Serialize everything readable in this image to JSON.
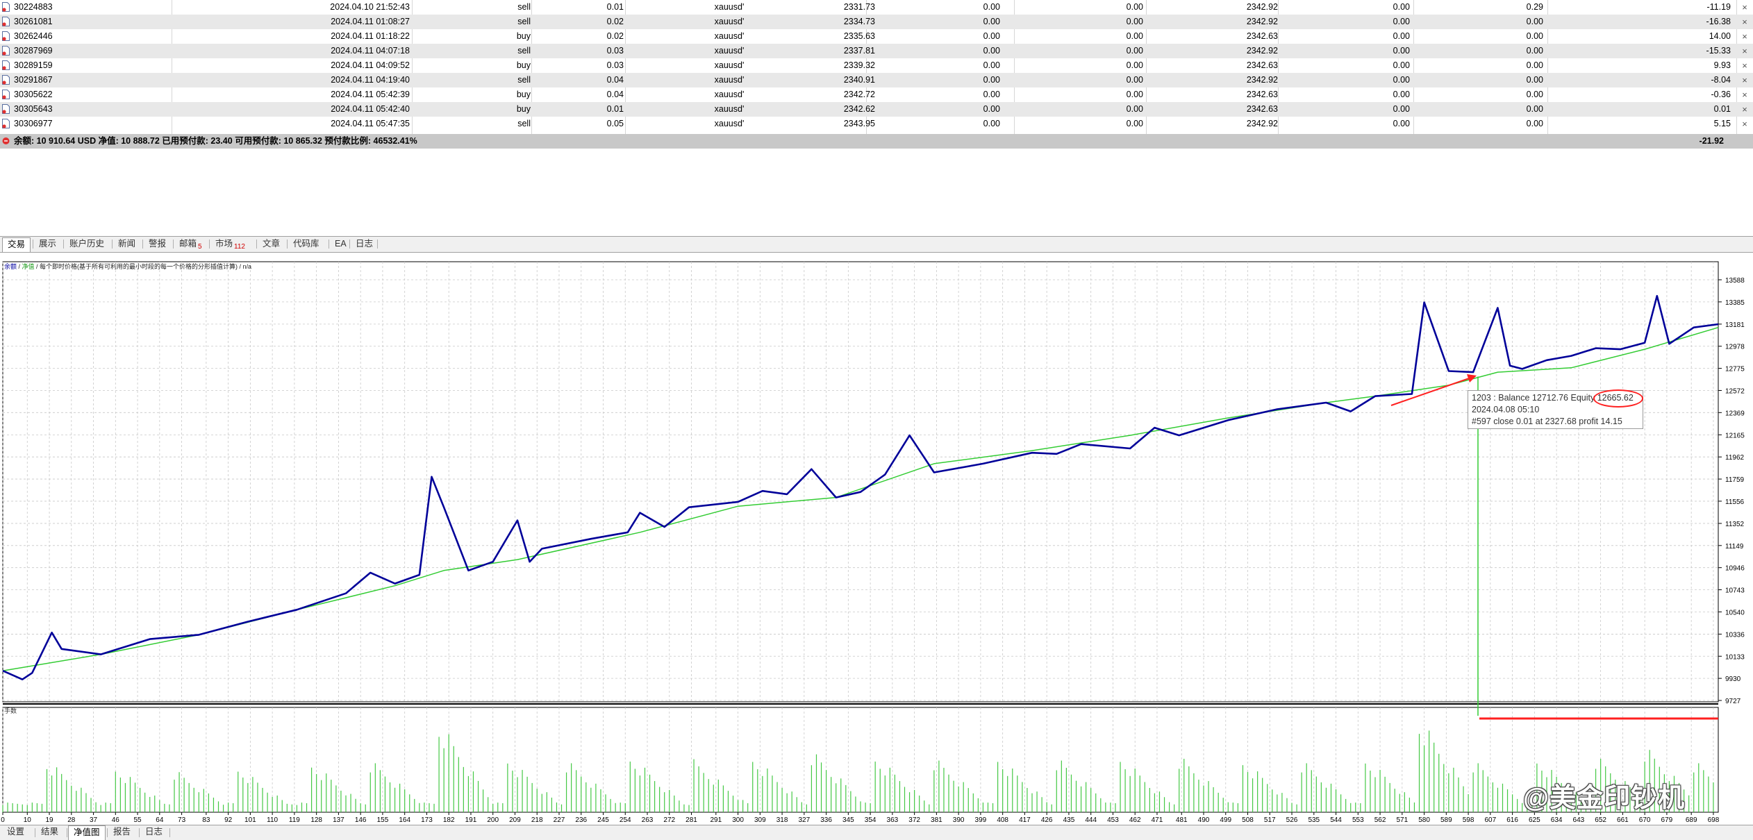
{
  "trades": [
    {
      "ticket": "30224883",
      "time": "2024.04.10 21:52:43",
      "type": "sell",
      "volume": "0.01",
      "symbol": "xauusd'",
      "price": "2331.73",
      "sl": "0.00",
      "tp": "0.00",
      "current": "2342.92",
      "commission": "0.00",
      "swap": "0.29",
      "profit": "-11.19"
    },
    {
      "ticket": "30261081",
      "time": "2024.04.11 01:08:27",
      "type": "sell",
      "volume": "0.02",
      "symbol": "xauusd'",
      "price": "2334.73",
      "sl": "0.00",
      "tp": "0.00",
      "current": "2342.92",
      "commission": "0.00",
      "swap": "0.00",
      "profit": "-16.38"
    },
    {
      "ticket": "30262446",
      "time": "2024.04.11 01:18:22",
      "type": "buy",
      "volume": "0.02",
      "symbol": "xauusd'",
      "price": "2335.63",
      "sl": "0.00",
      "tp": "0.00",
      "current": "2342.63",
      "commission": "0.00",
      "swap": "0.00",
      "profit": "14.00"
    },
    {
      "ticket": "30287969",
      "time": "2024.04.11 04:07:18",
      "type": "sell",
      "volume": "0.03",
      "symbol": "xauusd'",
      "price": "2337.81",
      "sl": "0.00",
      "tp": "0.00",
      "current": "2342.92",
      "commission": "0.00",
      "swap": "0.00",
      "profit": "-15.33"
    },
    {
      "ticket": "30289159",
      "time": "2024.04.11 04:09:52",
      "type": "buy",
      "volume": "0.03",
      "symbol": "xauusd'",
      "price": "2339.32",
      "sl": "0.00",
      "tp": "0.00",
      "current": "2342.63",
      "commission": "0.00",
      "swap": "0.00",
      "profit": "9.93"
    },
    {
      "ticket": "30291867",
      "time": "2024.04.11 04:19:40",
      "type": "sell",
      "volume": "0.04",
      "symbol": "xauusd'",
      "price": "2340.91",
      "sl": "0.00",
      "tp": "0.00",
      "current": "2342.92",
      "commission": "0.00",
      "swap": "0.00",
      "profit": "-8.04"
    },
    {
      "ticket": "30305622",
      "time": "2024.04.11 05:42:39",
      "type": "buy",
      "volume": "0.04",
      "symbol": "xauusd'",
      "price": "2342.72",
      "sl": "0.00",
      "tp": "0.00",
      "current": "2342.63",
      "commission": "0.00",
      "swap": "0.00",
      "profit": "-0.36"
    },
    {
      "ticket": "30305643",
      "time": "2024.04.11 05:42:40",
      "type": "buy",
      "volume": "0.01",
      "symbol": "xauusd'",
      "price": "2342.62",
      "sl": "0.00",
      "tp": "0.00",
      "current": "2342.63",
      "commission": "0.00",
      "swap": "0.00",
      "profit": "0.01"
    },
    {
      "ticket": "30306977",
      "time": "2024.04.11 05:47:35",
      "type": "sell",
      "volume": "0.05",
      "symbol": "xauusd'",
      "price": "2343.95",
      "sl": "0.00",
      "tp": "0.00",
      "current": "2342.92",
      "commission": "0.00",
      "swap": "0.00",
      "profit": "5.15"
    }
  ],
  "summary": {
    "text": "余额: 10 910.64 USD  净值: 10 888.72  已用预付款: 23.40  可用预付款: 10 865.32  预付款比例: 46532.41%",
    "total": "-21.92"
  },
  "top_tabs": [
    {
      "label": "交易",
      "active": true
    },
    {
      "label": "展示"
    },
    {
      "label": "账户历史"
    },
    {
      "label": "新闻"
    },
    {
      "label": "警报"
    },
    {
      "label": "邮箱",
      "badge": "5"
    },
    {
      "label": "市场",
      "badge": "112"
    },
    {
      "label": "文章"
    },
    {
      "label": "代码库"
    },
    {
      "label": "EA"
    },
    {
      "label": "日志"
    }
  ],
  "legend": {
    "balance": "余额",
    "sep1": " / ",
    "equity": "净值",
    "rest": " / 每个即时价格(基于所有可利用的最小时段的每一个价格的分形插值计算) / n/a"
  },
  "tooltip": {
    "line1": "1203 : Balance 12712.76 Equity 12665.62",
    "line2": "2024.04.08 05:10",
    "line3": "#597 close 0.01 at 2327.68 profit 14.15"
  },
  "subchart_label": "手数",
  "watermark": "@美金印钞机",
  "bottom_tabs": [
    {
      "label": "设置"
    },
    {
      "label": "结果"
    },
    {
      "label": "净值图",
      "active": true
    },
    {
      "label": "报告"
    },
    {
      "label": "日志"
    }
  ],
  "colors": {
    "balance": "#000099",
    "equity": "#33cc33",
    "volume": "#44c844",
    "annotation": "#ff2020",
    "grid": "#c8c8c8"
  },
  "chart_data": {
    "type": "line",
    "y_ticks": [
      "13588",
      "13385",
      "13181",
      "12978",
      "12775",
      "12572",
      "12369",
      "12165",
      "11962",
      "11759",
      "11556",
      "11352",
      "11149",
      "10946",
      "10743",
      "10540",
      "10336",
      "10133",
      "9930",
      "9727"
    ],
    "x_ticks": [
      "0",
      "10",
      "19",
      "28",
      "37",
      "46",
      "55",
      "64",
      "73",
      "83",
      "92",
      "101",
      "110",
      "119",
      "128",
      "137",
      "146",
      "155",
      "164",
      "173",
      "182",
      "191",
      "200",
      "209",
      "218",
      "227",
      "236",
      "245",
      "254",
      "263",
      "272",
      "281",
      "291",
      "300",
      "309",
      "318",
      "327",
      "336",
      "345",
      "354",
      "363",
      "372",
      "381",
      "390",
      "399",
      "408",
      "417",
      "426",
      "435",
      "444",
      "453",
      "462",
      "471",
      "481",
      "490",
      "499",
      "508",
      "517",
      "526",
      "535",
      "544",
      "553",
      "562",
      "571",
      "580",
      "589",
      "598",
      "607",
      "616",
      "625",
      "634",
      "643",
      "652",
      "661",
      "670",
      "679",
      "689",
      "698"
    ],
    "ylim": [
      9727,
      13588
    ],
    "xlim": [
      0,
      700
    ],
    "series": [
      {
        "name": "余额",
        "x": [
          0,
          40,
          80,
          120,
          160,
          180,
          210,
          260,
          300,
          340,
          380,
          420,
          460,
          500,
          540,
          560,
          590,
          610,
          640,
          670,
          700
        ],
        "y": [
          10000,
          10150,
          10330,
          10560,
          10780,
          10920,
          11020,
          11270,
          11510,
          11590,
          11900,
          12020,
          12160,
          12320,
          12460,
          12520,
          12620,
          12740,
          12780,
          12950,
          13150
        ]
      },
      {
        "name": "净值",
        "x": [
          0,
          8,
          12,
          20,
          24,
          40,
          60,
          80,
          100,
          120,
          140,
          150,
          160,
          170,
          175,
          180,
          190,
          200,
          210,
          215,
          220,
          240,
          255,
          260,
          270,
          280,
          300,
          310,
          320,
          330,
          340,
          350,
          360,
          370,
          380,
          400,
          420,
          430,
          440,
          460,
          470,
          480,
          500,
          520,
          540,
          550,
          560,
          575,
          580,
          590,
          600,
          610,
          615,
          620,
          630,
          640,
          650,
          660,
          670,
          675,
          680,
          690,
          700
        ],
        "y": [
          10000,
          9920,
          9980,
          10350,
          10200,
          10150,
          10290,
          10330,
          10450,
          10560,
          10710,
          10900,
          10800,
          10880,
          11780,
          11500,
          10920,
          11000,
          11380,
          11000,
          11120,
          11210,
          11270,
          11450,
          11320,
          11500,
          11550,
          11650,
          11620,
          11850,
          11590,
          11640,
          11800,
          12160,
          11820,
          11900,
          12000,
          11990,
          12080,
          12040,
          12230,
          12160,
          12300,
          12400,
          12460,
          12380,
          12520,
          12540,
          13380,
          12750,
          12740,
          13330,
          12800,
          12770,
          12850,
          12890,
          12960,
          12950,
          13010,
          13440,
          13000,
          13150,
          13180
        ]
      },
      {
        "name": "手数",
        "values": "bars"
      }
    ]
  }
}
